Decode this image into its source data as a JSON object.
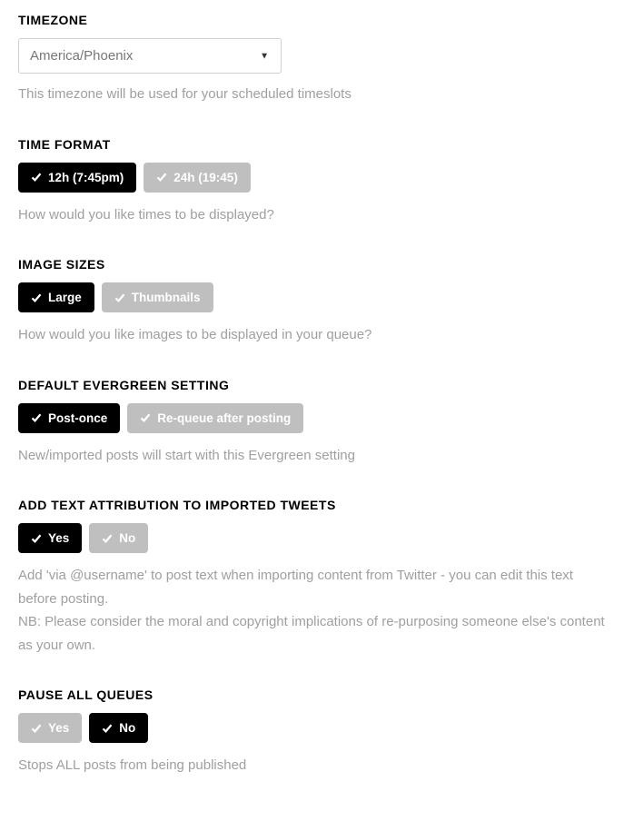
{
  "timezone": {
    "title": "TIMEZONE",
    "value": "America/Phoenix",
    "helper": "This timezone will be used for your scheduled timeslots"
  },
  "timeFormat": {
    "title": "TIME FORMAT",
    "options": {
      "a": "12h (7:45pm)",
      "b": "24h (19:45)"
    },
    "selected": "a",
    "helper": "How would you like times to be displayed?"
  },
  "imageSizes": {
    "title": "IMAGE SIZES",
    "options": {
      "a": "Large",
      "b": "Thumbnails"
    },
    "selected": "a",
    "helper": "How would you like images to be displayed in your queue?"
  },
  "evergreen": {
    "title": "DEFAULT EVERGREEN SETTING",
    "options": {
      "a": "Post-once",
      "b": "Re-queue after posting"
    },
    "selected": "a",
    "helper": "New/imported posts will start with this Evergreen setting"
  },
  "attribution": {
    "title": "ADD TEXT ATTRIBUTION TO IMPORTED TWEETS",
    "options": {
      "a": "Yes",
      "b": "No"
    },
    "selected": "a",
    "helper1": "Add 'via @username' to post text when importing content from Twitter - you can edit this text before posting.",
    "helper2": "NB: Please consider the moral and copyright implications of re-purposing someone else's content as your own."
  },
  "pause": {
    "title": "PAUSE ALL QUEUES",
    "options": {
      "a": "Yes",
      "b": "No"
    },
    "selected": "b",
    "helper": "Stops ALL posts from being published"
  }
}
